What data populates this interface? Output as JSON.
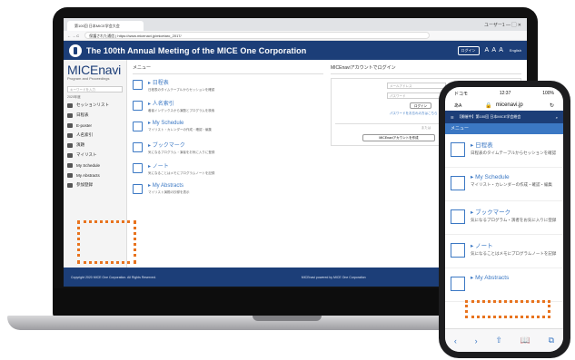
{
  "browser": {
    "tab_title": "第100回 日本MICE学会大会",
    "window_controls": "ユーザー1  —  ▢  ✕",
    "nav_buttons": "← → C",
    "url": "保護された通信 | https://www.micenavi.jp/micetaro_2017/"
  },
  "site": {
    "title": "The 100th Annual Meeting of the MICE One Corporation",
    "login_button": "ログイン",
    "font_size": "A A A",
    "language": "English",
    "footer_left": "Copyright 2020 MICE One Corporation. All Rights Reserved.",
    "footer_right": "MICEnavi powered by MICE One Corporation"
  },
  "sidebar": {
    "brand": "MICEnavi",
    "brand_sub": "Program and Proceedings",
    "search_placeholder": "キーワードを入力",
    "year": "2020年度",
    "items": [
      {
        "label": "セッションリスト",
        "icon": "list-icon"
      },
      {
        "label": "日程表",
        "icon": "calendar-icon"
      },
      {
        "label": "E-poster",
        "icon": "poster-icon"
      },
      {
        "label": "人名索引",
        "icon": "person-icon"
      },
      {
        "label": "演題",
        "icon": "abstract-icon"
      },
      {
        "label": "マイリスト",
        "icon": "mylist-icon"
      },
      {
        "label": "My Schedule",
        "icon": "schedule-icon"
      },
      {
        "label": "My Abstracts",
        "icon": "abstracts-icon"
      },
      {
        "label": "参加登録",
        "icon": "register-icon"
      }
    ]
  },
  "menu": {
    "heading": "メニュー",
    "items": [
      {
        "title": "日程表",
        "desc": "日程表のタイムテーブルからセッションを確認",
        "icon": "calendar-icon"
      },
      {
        "title": "人名索引",
        "desc": "著者インデックスから演題とプログラムを検索",
        "icon": "people-icon"
      },
      {
        "title": "My Schedule",
        "desc": "マイリスト・カレンダーの作成・確認・編集",
        "icon": "schedule-icon"
      },
      {
        "title": "ブックマーク",
        "desc": "気になるプログラム・演者をお気に入りに登録",
        "icon": "bookmark-icon"
      },
      {
        "title": "ノート",
        "desc": "気になることはメモにプログラムノートを記録",
        "icon": "note-icon"
      },
      {
        "title": "My Abstracts",
        "desc": "マイリスト演題の抄録を表示",
        "icon": "books-icon"
      }
    ]
  },
  "login": {
    "heading": "MICEnaviアカウントでログイン",
    "email_placeholder": "メールアドレス",
    "password_placeholder": "パスワード",
    "submit": "ログイン",
    "forgot": "パスワードをお忘れの方はこちら",
    "separator": "または",
    "create": "MICEnaviアカウントを作成"
  },
  "phone": {
    "carrier": "ドコモ",
    "time": "12:37",
    "battery": "100%",
    "aa": "あA",
    "url": "micenavi.jp",
    "header_title": "【開催中】第100回 日本MICE学会総会",
    "menu_label": "メニュー",
    "items": [
      {
        "title": "日程表",
        "desc": "日程表のタイムテーブルからセッションを確認"
      },
      {
        "title": "My Schedule",
        "desc": "マイリスト・カレンダーの作成・確認・編集"
      },
      {
        "title": "ブックマーク",
        "desc": "気になるプログラム・演者をお気に入りに登録"
      },
      {
        "title": "ノート",
        "desc": "気になることはメモにプログラムノートを記録"
      },
      {
        "title": "My Abstracts",
        "desc": ""
      }
    ],
    "toolbar": [
      "‹",
      "›",
      "⇧",
      "📖",
      "⧉"
    ]
  },
  "colors": {
    "brand_navy": "#1c3e78",
    "accent_blue": "#3b78c4",
    "highlight_orange": "#e8731e"
  }
}
